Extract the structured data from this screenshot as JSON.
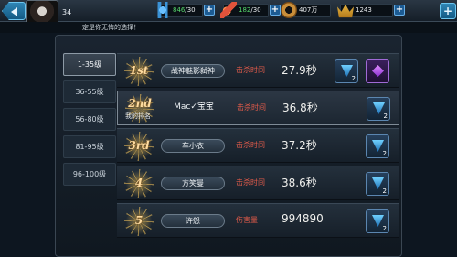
{
  "header": {
    "level": "34",
    "resources": [
      {
        "icon": "wings-icon",
        "value": "846",
        "max": "/30"
      },
      {
        "icon": "stamina-icon",
        "value": "182",
        "max": "/30"
      },
      {
        "icon": "coin-icon",
        "value": "407万"
      },
      {
        "icon": "crown-icon",
        "value": "1243"
      }
    ],
    "plus": "+",
    "settings": "+",
    "subtitle": "定是你无悔的选择！"
  },
  "tabs": [
    "1-35级",
    "36-55级",
    "56-80级",
    "81-95级",
    "96-100级"
  ],
  "active_tab": 0,
  "rows": [
    {
      "rank": "1st",
      "name": "战神魅影弑神",
      "stat_label": "击杀时间",
      "stat_value": "27.9秒",
      "rewards": [
        {
          "count": "2"
        },
        {
          "count": ""
        }
      ]
    },
    {
      "rank": "2nd",
      "my_label": "我的排名",
      "name": "Mac✓宝宝",
      "stat_label": "击杀时间",
      "stat_value": "36.8秒",
      "rewards": [
        {
          "count": "2"
        }
      ]
    },
    {
      "rank": "3rd",
      "name": "车小衣",
      "stat_label": "击杀时间",
      "stat_value": "37.2秒",
      "rewards": [
        {
          "count": "2"
        }
      ]
    },
    {
      "rank": "4",
      "name": "方笑曼",
      "stat_label": "击杀时间",
      "stat_value": "38.6秒",
      "rewards": [
        {
          "count": "2"
        }
      ]
    },
    {
      "rank": "5",
      "name": "许怨",
      "stat_label": "伤害量",
      "stat_value": "994890",
      "rewards": [
        {
          "count": "2"
        }
      ]
    }
  ]
}
